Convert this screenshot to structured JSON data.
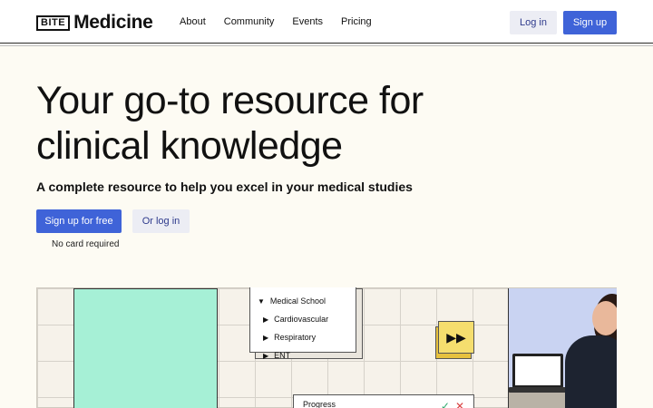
{
  "brand": {
    "box": "BITE",
    "name": "Medicine"
  },
  "nav": [
    "About",
    "Community",
    "Events",
    "Pricing"
  ],
  "header_buttons": {
    "login": "Log in",
    "signup": "Sign up"
  },
  "hero": {
    "title": "Your go-to resource for clinical knowledge",
    "subtitle": "A complete resource to help you excel in your medical studies",
    "primary_cta": "Sign up for free",
    "secondary_cta": "Or log in",
    "note": "No card required"
  },
  "illustration": {
    "tree": {
      "root": "Medical School",
      "children": [
        "Cardiovascular",
        "Respiratory",
        "ENT"
      ]
    },
    "fast_forward_icon": "fast-forward-icon",
    "progress_label": "Progress",
    "colors": {
      "mint": "#a6f0d6",
      "yellow": "#f5de6e",
      "blue": "#3f63d8"
    }
  }
}
